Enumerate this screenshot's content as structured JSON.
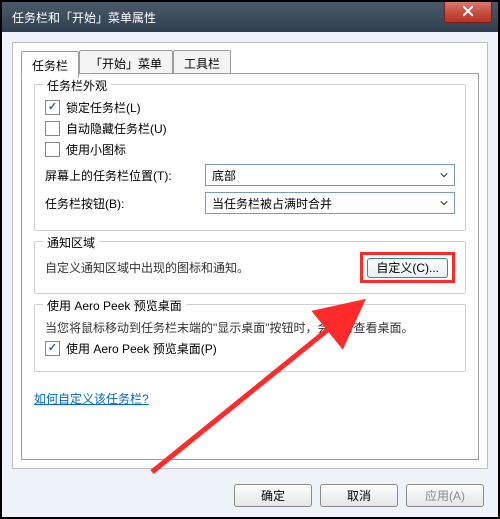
{
  "window": {
    "title": "任务栏和「开始」菜单属性"
  },
  "tabs": {
    "taskbar": "任务栏",
    "startmenu": "「开始」菜单",
    "toolbars": "工具栏"
  },
  "appearance": {
    "title": "任务栏外观",
    "lock": "锁定任务栏(L)",
    "autohide": "自动隐藏任务栏(U)",
    "smallicons": "使用小图标",
    "location_label": "屏幕上的任务栏位置(T):",
    "location_value": "底部",
    "buttons_label": "任务栏按钮(B):",
    "buttons_value": "当任务栏被占满时合并"
  },
  "notification": {
    "title": "通知区域",
    "desc": "自定义通知区域中出现的图标和通知。",
    "customize": "自定义(C)..."
  },
  "aero": {
    "title": "使用 Aero Peek 预览桌面",
    "desc": "当您将鼠标移动到任务栏末端的\"显示桌面\"按钮时，会暂时查看桌面。",
    "chk": "使用 Aero Peek 预览桌面(P)"
  },
  "help_link": "如何自定义该任务栏?",
  "buttons": {
    "ok": "确定",
    "cancel": "取消",
    "apply": "应用(A)"
  }
}
